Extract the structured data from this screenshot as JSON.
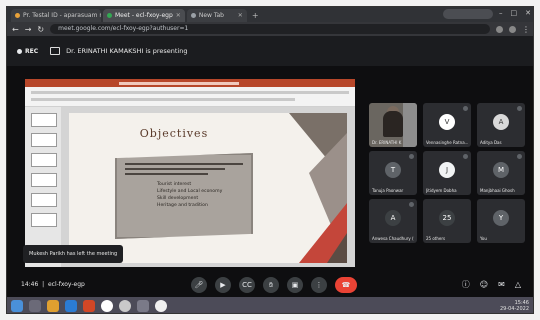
{
  "browser": {
    "tabs": [
      {
        "label": "Pr. Testal ID - aparasuam ronsege",
        "active": false
      },
      {
        "label": "Meet - ecl-fxoy-egp",
        "active": true
      },
      {
        "label": "New Tab",
        "active": false
      }
    ],
    "url": "meet.google.com/ecl-fxoy-egp?authuser=1"
  },
  "meet": {
    "rec_label": "REC",
    "presenting_text": "Dr. ERINATHI KAMAKSHI is presenting",
    "meeting_time": "14:46",
    "meeting_code": "ecl-fxoy-egp",
    "toast": "Mukesh Parikh has left the meeting"
  },
  "slide": {
    "title": "Objectives",
    "bullets": [
      "Tourist interest",
      "Lifestyle and Local economy",
      "Skill development",
      "Heritage and tradition"
    ]
  },
  "participants": [
    {
      "name": "Dr. ERINATHI K",
      "type": "video",
      "letter": "",
      "color": ""
    },
    {
      "name": "Vennasinghe Ratna...",
      "type": "avatar",
      "letter": "V",
      "color": "#ffffff"
    },
    {
      "name": "Aditya Das",
      "type": "avatar",
      "letter": "A",
      "color": "#d9d9d9"
    },
    {
      "name": "Tanuja Paonwar",
      "type": "avatar",
      "letter": "T",
      "color": "#5f6368"
    },
    {
      "name": "Jitidyem Dobha",
      "type": "avatar",
      "letter": "J",
      "color": "#f1f3f4"
    },
    {
      "name": "Manjbhaai Ghosh",
      "type": "avatar",
      "letter": "M",
      "color": "#5f6368"
    },
    {
      "name": "Anwesa Chaudhury (you)",
      "type": "avatar",
      "letter": "A",
      "color": "#3c4043"
    },
    {
      "name": "25 others",
      "type": "avatar",
      "letter": "25",
      "color": "#3c4043"
    },
    {
      "name": "You",
      "type": "avatar",
      "letter": "Y",
      "color": "#5f6368"
    }
  ],
  "controls": {
    "mic_icon": "mic-icon",
    "cam_icon": "camera-icon",
    "cc_icon": "captions-icon",
    "hand_icon": "hand-icon",
    "present_icon": "present-icon",
    "more_icon": "more-icon",
    "end_icon": "end-call-icon"
  },
  "taskbar": {
    "clock": "15:46",
    "date": "29-04-2022"
  }
}
